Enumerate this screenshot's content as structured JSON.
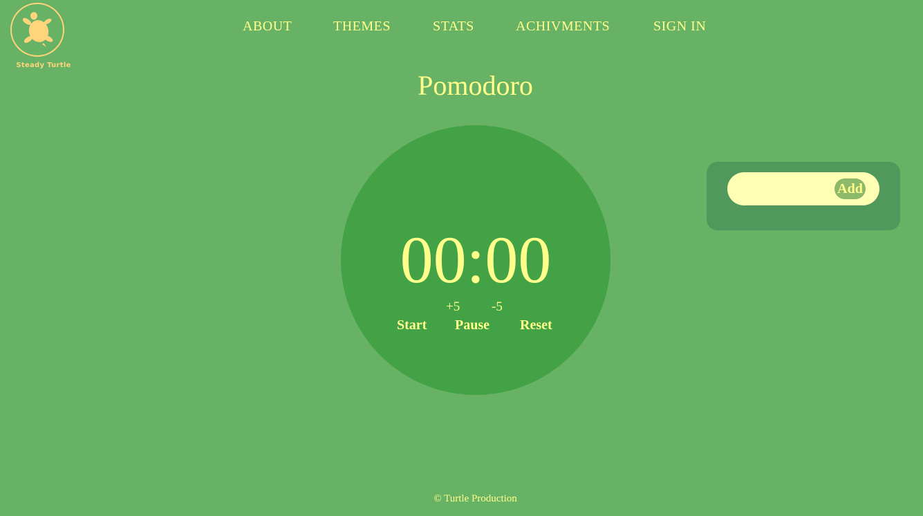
{
  "brand": {
    "name": "Steady Turtle"
  },
  "nav": {
    "about": "ABOUT",
    "themes": "THEMES",
    "stats": "STATS",
    "achievements": "ACHIVMENTS",
    "sign_in": "SIGN IN"
  },
  "page": {
    "title": "Pomodoro"
  },
  "timer": {
    "display": "00:00",
    "plus_label": "+5",
    "minus_label": "-5",
    "start_label": "Start",
    "pause_label": "Pause",
    "reset_label": "Reset"
  },
  "tasks": {
    "input_value": "",
    "add_label": "Add"
  },
  "footer": {
    "text": "© Turtle Production"
  },
  "colors": {
    "background": "#68b265",
    "circle": "#43a246",
    "text": "#ffff8c",
    "panel": "#50985b",
    "input": "#ffffb4",
    "logo": "#ffd47a"
  },
  "icons": {
    "logo": "turtle-icon"
  }
}
